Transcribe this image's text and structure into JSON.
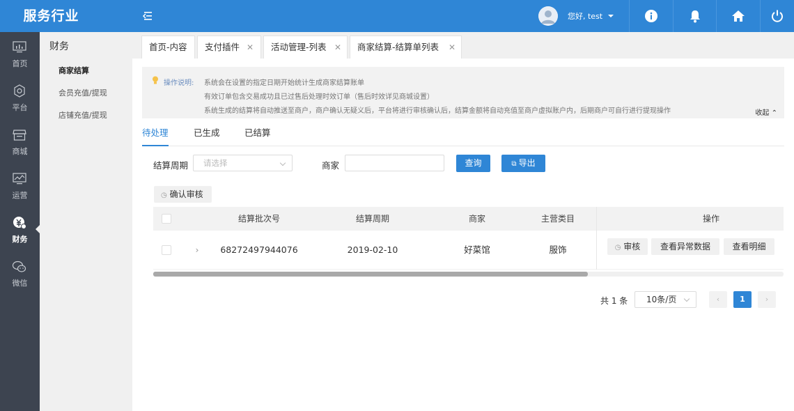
{
  "app": {
    "brand": "服务行业"
  },
  "header": {
    "user_greeting": "您好, test",
    "icons": [
      "info-icon",
      "bell-icon",
      "home-icon",
      "power-icon"
    ]
  },
  "leftnav": {
    "items": [
      {
        "label": "首页",
        "icon": "monitor-icon"
      },
      {
        "label": "平台",
        "icon": "gear-icon"
      },
      {
        "label": "商城",
        "icon": "store-icon"
      },
      {
        "label": "运营",
        "icon": "chart-icon"
      },
      {
        "label": "财务",
        "icon": "finance-icon",
        "active": true
      },
      {
        "label": "微信",
        "icon": "wechat-icon"
      }
    ]
  },
  "submenu": {
    "title": "财务",
    "items": [
      {
        "label": "商家结算",
        "active": true
      },
      {
        "label": "会员充值/提现"
      },
      {
        "label": "店铺充值/提现"
      }
    ]
  },
  "tabs": [
    {
      "label": "首页-内容",
      "closable": false
    },
    {
      "label": "支付插件",
      "closable": true
    },
    {
      "label": "活动管理-列表",
      "closable": true
    },
    {
      "label": "商家结算-结算单列表",
      "closable": true,
      "active": true
    }
  ],
  "notice": {
    "label": "操作说明:",
    "lines": [
      "系统会在设置的指定日期开始统计生成商家结算账单",
      "有效订单包含交易成功且已过售后处理时效订单（售后时效详见商城设置）",
      "系统生成的结算将自动推送至商户，商户确认无疑义后，平台将进行审核确认后，结算金额将自动充值至商户虚拟账户内，后期商户可自行进行提现操作"
    ],
    "collapse_label": "收起"
  },
  "status_tabs": [
    {
      "label": "待处理",
      "active": true
    },
    {
      "label": "已生成"
    },
    {
      "label": "已结算"
    }
  ],
  "filters": {
    "period_label": "结算周期",
    "period_placeholder": "请选择",
    "merchant_label": "商家",
    "merchant_value": "",
    "query_button": "查询",
    "export_button": "导出"
  },
  "bulk_action": "确认审核",
  "table": {
    "columns": [
      "结算批次号",
      "结算周期",
      "商家",
      "主营类目",
      "操作"
    ],
    "rows": [
      {
        "batch_no": "68272497944076",
        "period": "2019-02-10",
        "merchant": "好菜馆",
        "category": "服饰",
        "actions": [
          "审核",
          "查看异常数据",
          "查看明细"
        ]
      }
    ]
  },
  "pagination": {
    "total": "共 1 条",
    "page_size": "10条/页",
    "current_page": "1"
  },
  "colors": {
    "primary": "#2f86d6",
    "nav_dark": "#3d4450",
    "submenu_bg": "#f0f0f0"
  }
}
